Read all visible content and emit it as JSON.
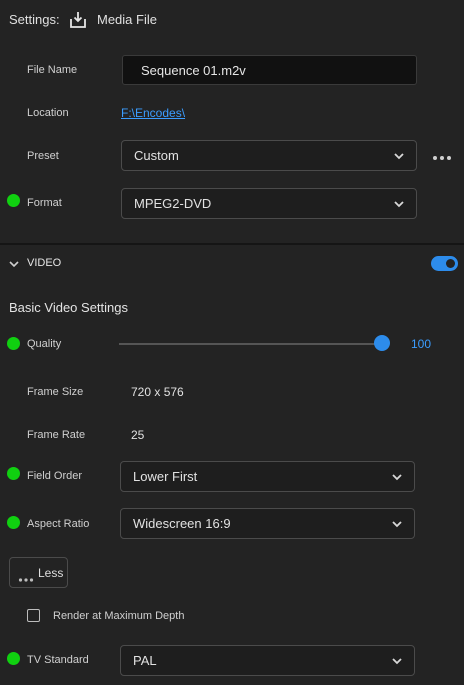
{
  "header": {
    "settings_label": "Settings:",
    "media_icon": "download-tray-icon",
    "media_label": "Media File"
  },
  "file": {
    "name_label": "File Name",
    "name_value": "Sequence 01.m2v",
    "location_label": "Location",
    "location_value": "F:\\Encodes\\",
    "preset_label": "Preset",
    "preset_value": "Custom",
    "format_label": "Format",
    "format_value": "MPEG2-DVD"
  },
  "video": {
    "section_label": "VIDEO",
    "toggle_on": true,
    "basic_title": "Basic Video Settings",
    "quality_label": "Quality",
    "quality_value": "100",
    "quality_fraction": 1.0,
    "frame_size_label": "Frame Size",
    "frame_size_value": "720 x 576",
    "frame_rate_label": "Frame Rate",
    "frame_rate_value": "25",
    "field_order_label": "Field Order",
    "field_order_value": "Lower First",
    "aspect_label": "Aspect Ratio",
    "aspect_value": "Widescreen 16:9",
    "less_label": "Less",
    "render_max_label": "Render at Maximum Depth",
    "render_max_checked": false,
    "tv_standard_label": "TV Standard",
    "tv_standard_value": "PAL"
  },
  "colors": {
    "background": "#232323",
    "accent_blue": "#2d8ceb",
    "link_blue": "#3b9dff",
    "indicator_green": "#10d010"
  }
}
